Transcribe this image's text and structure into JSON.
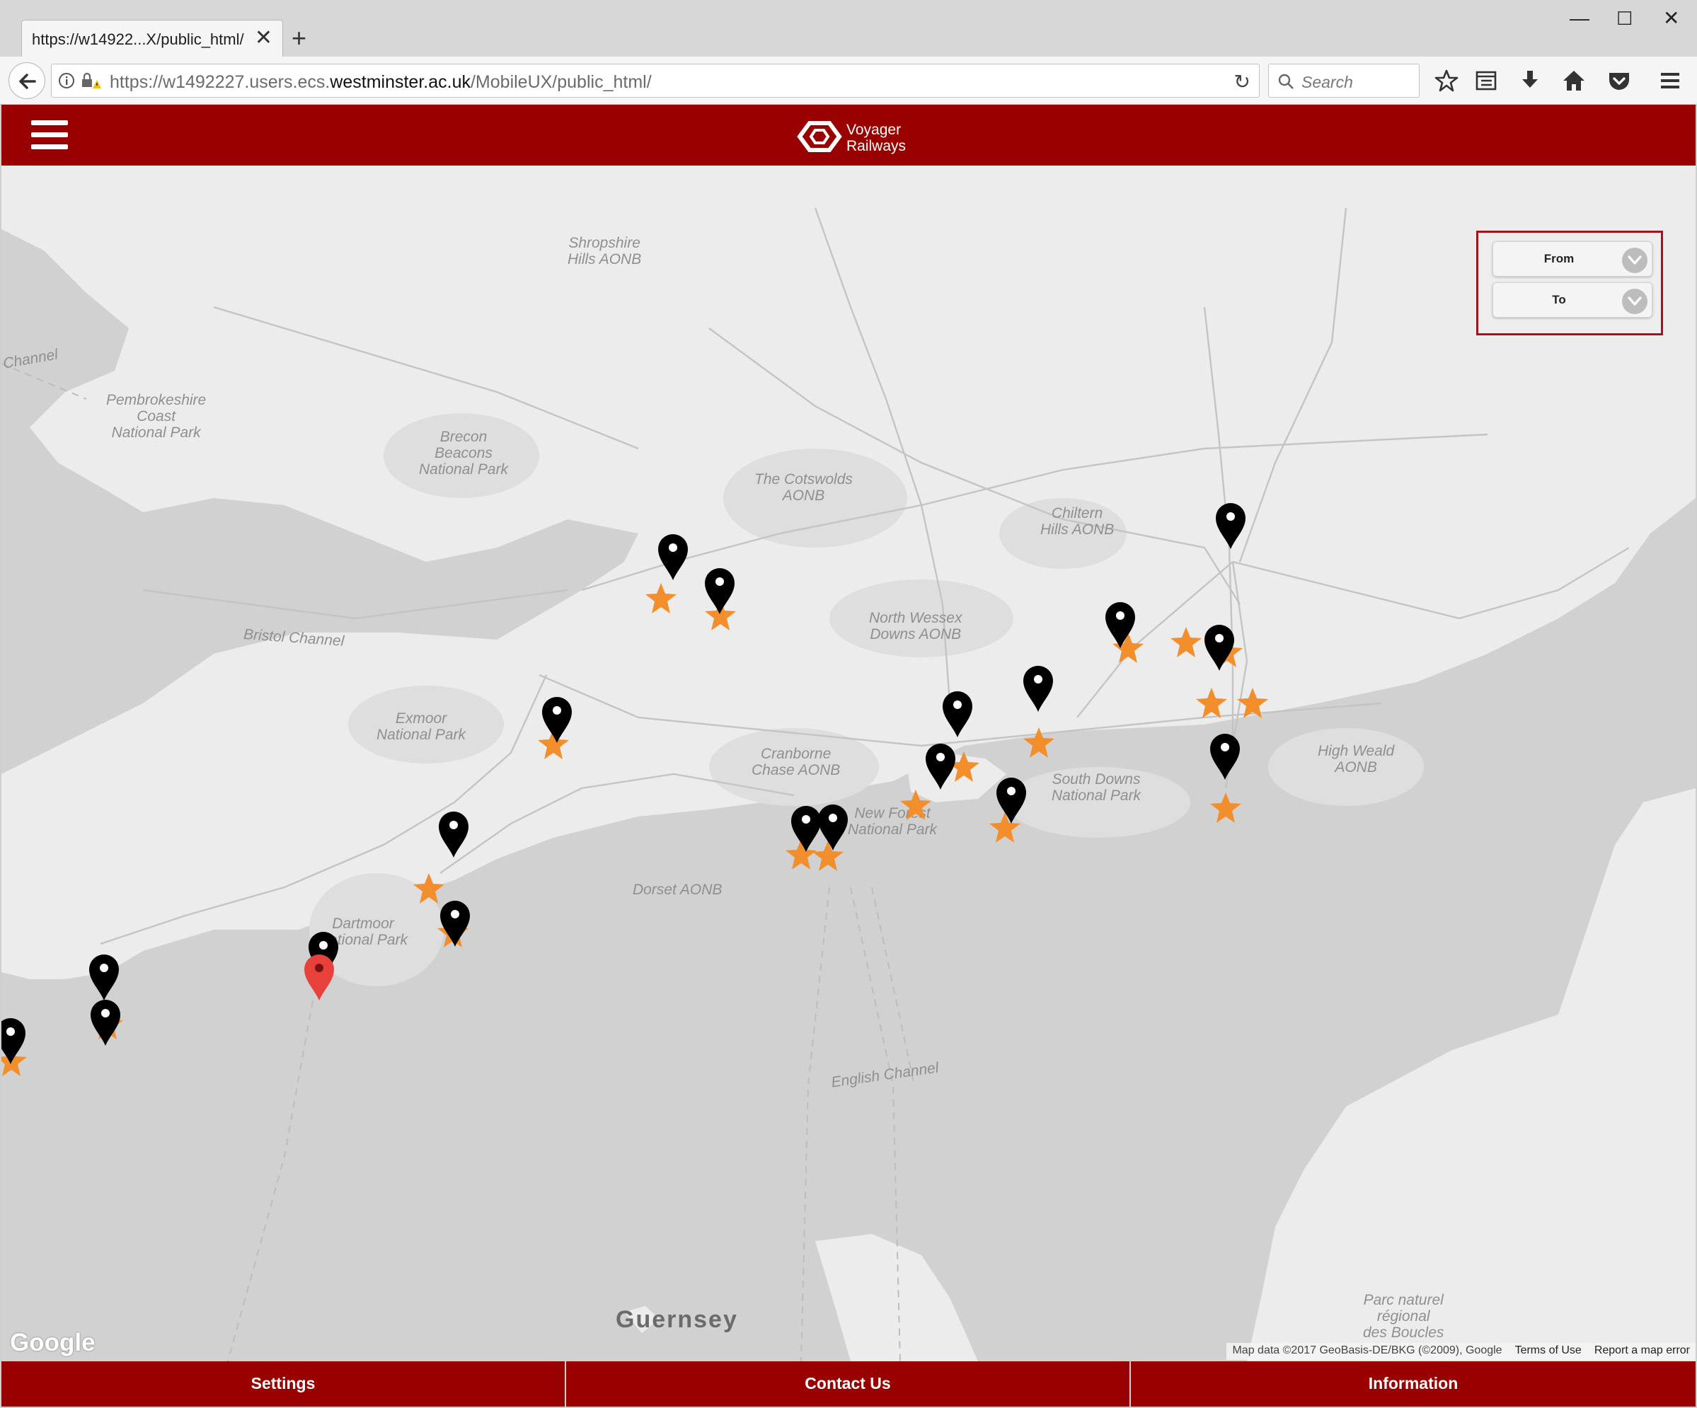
{
  "browser": {
    "tab_title": "https://w14922...X/public_html/",
    "tab_close": "✕",
    "new_tab": "+",
    "window_controls": {
      "minimize": "—",
      "maximize": "☐",
      "close": "✕"
    },
    "url_prefix": "https://w1492227.users.ecs.",
    "url_host": "westminster.ac.uk",
    "url_suffix": "/MobileUX/public_html/",
    "reload_icon": "↻",
    "search_placeholder": "Search",
    "toolbar_icons": [
      "star-icon",
      "reading-list-icon",
      "download-icon",
      "home-icon",
      "pocket-icon",
      "menu-icon"
    ]
  },
  "app": {
    "brand_line1": "Voyager",
    "brand_line2": "Railways",
    "from_label": "From",
    "to_label": "To",
    "accent_color": "#990000"
  },
  "map": {
    "labels": {
      "shropshire": "Shropshire\nHills AONB",
      "channel": "Channel",
      "pembrokeshire": "Pembrokeshire\nCoast\nNational Park",
      "brecon": "Brecon\nBeacons\nNational Park",
      "cotswolds": "The Cotswolds\nAONB",
      "chiltern": "Chiltern\nHills AONB",
      "bristol_channel": "Bristol Channel",
      "north_wessex": "North Wessex\nDowns AONB",
      "exmoor": "Exmoor\nNational Park",
      "cranborne": "Cranborne\nChase AONB",
      "south_downs": "South Downs\nNational Park",
      "high_weald": "High Weald\nAONB",
      "new_forest": "New Forest\nNational Park",
      "dorset": "Dorset AONB",
      "dartmoor": "Dartmoor\nNational Park",
      "english_channel": "English Channel",
      "guernsey": "Guernsey",
      "parc": "Parc naturel\nrégional\ndes Boucles"
    },
    "google_logo": "Google",
    "attribution": "Map data ©2017 GeoBasis-DE/BKG (©2009), Google",
    "terms": "Terms of Use",
    "report": "Report a map error",
    "marker_color": "#000000",
    "star_color": "#f28e2b",
    "selected_marker_color": "#e8413b"
  },
  "footer": {
    "settings": "Settings",
    "contact": "Contact Us",
    "information": "Information"
  }
}
